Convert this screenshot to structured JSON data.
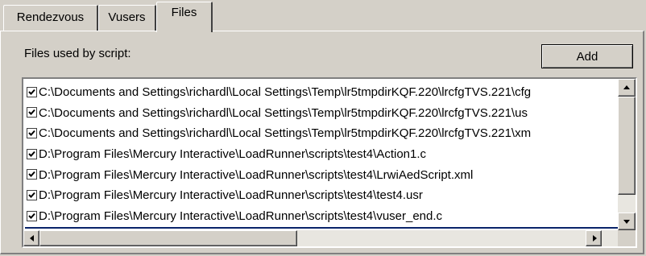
{
  "tabs": [
    {
      "label": "Rendezvous",
      "active": false
    },
    {
      "label": "Vusers",
      "active": false
    },
    {
      "label": "Files",
      "active": true
    }
  ],
  "files_section": {
    "label": "Files used by script:",
    "add_button": "Add"
  },
  "file_list": [
    {
      "checked": true,
      "path": "C:\\Documents and Settings\\richardl\\Local Settings\\Temp\\lr5tmpdirKQF.220\\lrcfgTVS.221\\cfg"
    },
    {
      "checked": true,
      "path": "C:\\Documents and Settings\\richardl\\Local Settings\\Temp\\lr5tmpdirKQF.220\\lrcfgTVS.221\\us"
    },
    {
      "checked": true,
      "path": "C:\\Documents and Settings\\richardl\\Local Settings\\Temp\\lr5tmpdirKQF.220\\lrcfgTVS.221\\xm"
    },
    {
      "checked": true,
      "path": "D:\\Program Files\\Mercury Interactive\\LoadRunner\\scripts\\test4\\Action1.c"
    },
    {
      "checked": true,
      "path": "D:\\Program Files\\Mercury Interactive\\LoadRunner\\scripts\\test4\\LrwiAedScript.xml"
    },
    {
      "checked": true,
      "path": "D:\\Program Files\\Mercury Interactive\\LoadRunner\\scripts\\test4\\test4.usr"
    },
    {
      "checked": true,
      "path": "D:\\Program Files\\Mercury Interactive\\LoadRunner\\scripts\\test4\\vuser_end.c"
    }
  ],
  "icons": {
    "scroll_up": "up-arrow-icon",
    "scroll_down": "down-arrow-icon",
    "scroll_left": "left-arrow-icon",
    "scroll_right": "right-arrow-icon",
    "checkbox": "checkmark-icon"
  },
  "colors": {
    "dialog_bg": "#d4d0c8",
    "list_bg": "#ffffff",
    "selection": "#0a246a"
  }
}
